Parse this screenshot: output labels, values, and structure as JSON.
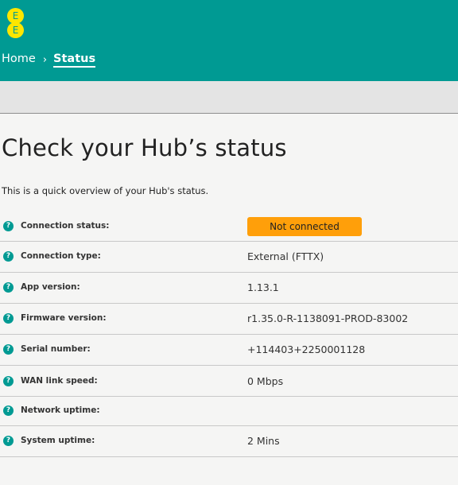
{
  "brand": {
    "logo_letters": [
      "E",
      "E"
    ],
    "primary_color": "#009a93",
    "logo_color": "#ffe600"
  },
  "breadcrumb": {
    "home": "Home",
    "separator": "›",
    "current": "Status"
  },
  "page": {
    "title": "Check your Hub’s status",
    "intro": "This is a quick overview of your Hub's status."
  },
  "status": {
    "help_icon_glyph": "?",
    "badge_color": "#ff9f0a",
    "rows": [
      {
        "label": "Connection status:",
        "value": "Not connected",
        "kind": "badge"
      },
      {
        "label": "Connection type:",
        "value": "External (FTTX)",
        "kind": "text"
      },
      {
        "label": "App version:",
        "value": "1.13.1",
        "kind": "text"
      },
      {
        "label": "Firmware version:",
        "value": "r1.35.0-R-1138091-PROD-83002",
        "kind": "text"
      },
      {
        "label": "Serial number:",
        "value": "+114403+2250001128",
        "kind": "text"
      },
      {
        "label": "WAN link speed:",
        "value": "0 Mbps",
        "kind": "text"
      },
      {
        "label": "Network uptime:",
        "value": "",
        "kind": "text"
      },
      {
        "label": "System uptime:",
        "value": "2 Mins",
        "kind": "text"
      }
    ]
  }
}
